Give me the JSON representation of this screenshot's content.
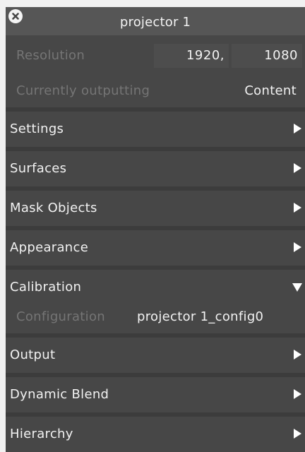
{
  "panel": {
    "title": "projector 1",
    "close_icon": "close-icon"
  },
  "resolution": {
    "label": "Resolution",
    "width": "1920,",
    "height": "1080"
  },
  "output_status": {
    "label": "Currently outputting",
    "value": "Content"
  },
  "sections": [
    {
      "label": "Settings",
      "state": "collapsed"
    },
    {
      "label": "Surfaces",
      "state": "collapsed"
    },
    {
      "label": "Mask Objects",
      "state": "collapsed"
    },
    {
      "label": "Appearance",
      "state": "collapsed"
    },
    {
      "label": "Calibration",
      "state": "expanded"
    },
    {
      "label": "Output",
      "state": "collapsed"
    },
    {
      "label": "Dynamic Blend",
      "state": "collapsed"
    },
    {
      "label": "Hierarchy",
      "state": "collapsed"
    }
  ],
  "calibration": {
    "configuration_label": "Configuration",
    "configuration_value": "projector 1_config0"
  },
  "colors": {
    "panel_bg": "#474747",
    "header_bg": "#565656",
    "separator": "#3c3c3c",
    "dim_text": "#757575",
    "text": "#f2f2f2"
  }
}
